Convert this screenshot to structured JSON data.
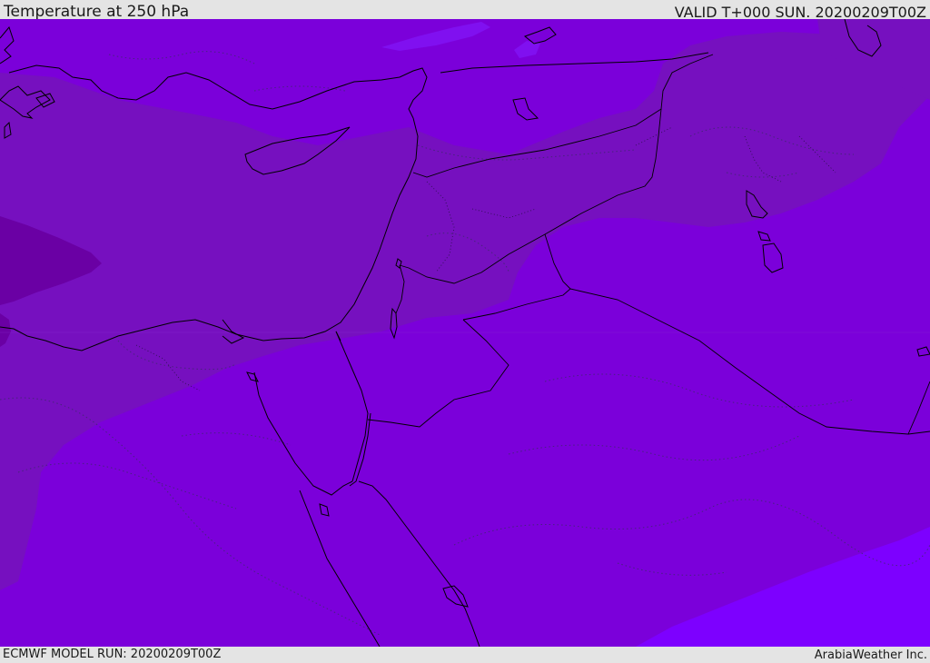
{
  "header": {
    "title": "Temperature at 250 hPa",
    "valid": "VALID T+000 SUN. 20200209T00Z"
  },
  "footer": {
    "model_run": "ECMWF MODEL RUN: 20200209T00Z",
    "credit": "ArabiaWeather Inc."
  },
  "map": {
    "colors": {
      "base": "#7b00da",
      "warm_band": "#7610bf",
      "cold_core": "#6a00a4",
      "light_band": "#7d00ff",
      "pale_patch": "#8010f0",
      "coastline": "#000000",
      "isotherm": "#3d2a6b"
    }
  }
}
